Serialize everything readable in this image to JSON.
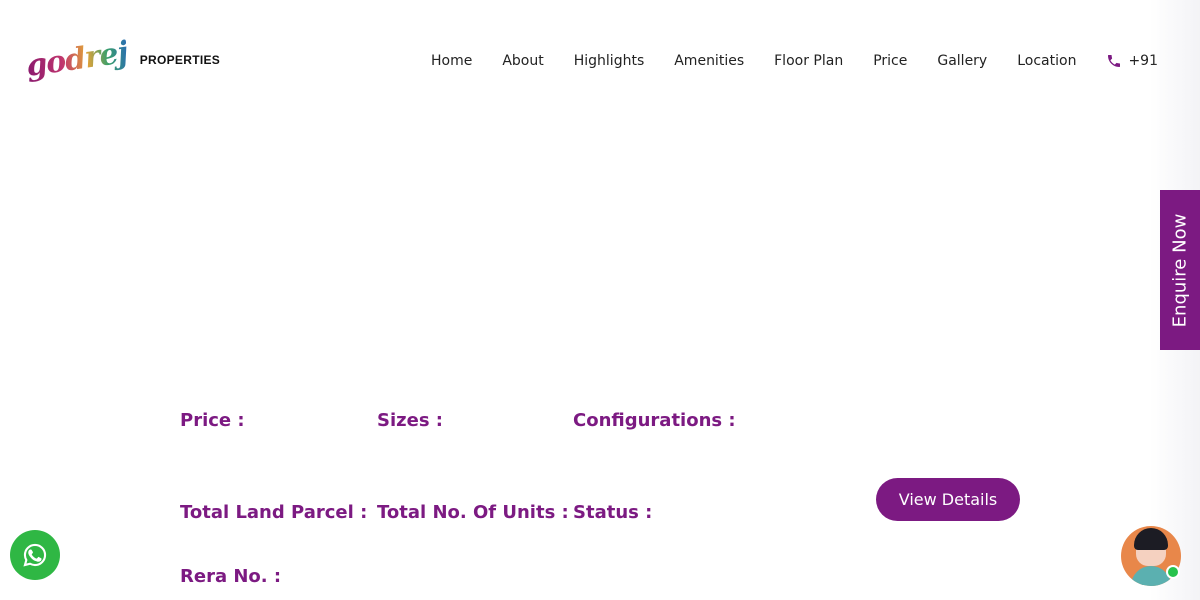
{
  "brand": {
    "script": "godrej",
    "text": "PROPERTIES"
  },
  "nav": {
    "items": [
      "Home",
      "About",
      "Highlights",
      "Amenities",
      "Floor Plan",
      "Price",
      "Gallery",
      "Location"
    ],
    "phone": "+91"
  },
  "enquire": {
    "label": "Enquire Now"
  },
  "details": {
    "price_label": "Price :",
    "sizes_label": "Sizes :",
    "configurations_label": "Configurations :",
    "land_parcel_label": "Total Land Parcel :",
    "units_label": "Total No. Of Units :",
    "status_label": "Status :",
    "rera_label": "Rera No. :"
  },
  "cta": {
    "view_details": "View Details"
  },
  "colors": {
    "accent": "#7c1a82",
    "whatsapp": "#2fb744"
  }
}
